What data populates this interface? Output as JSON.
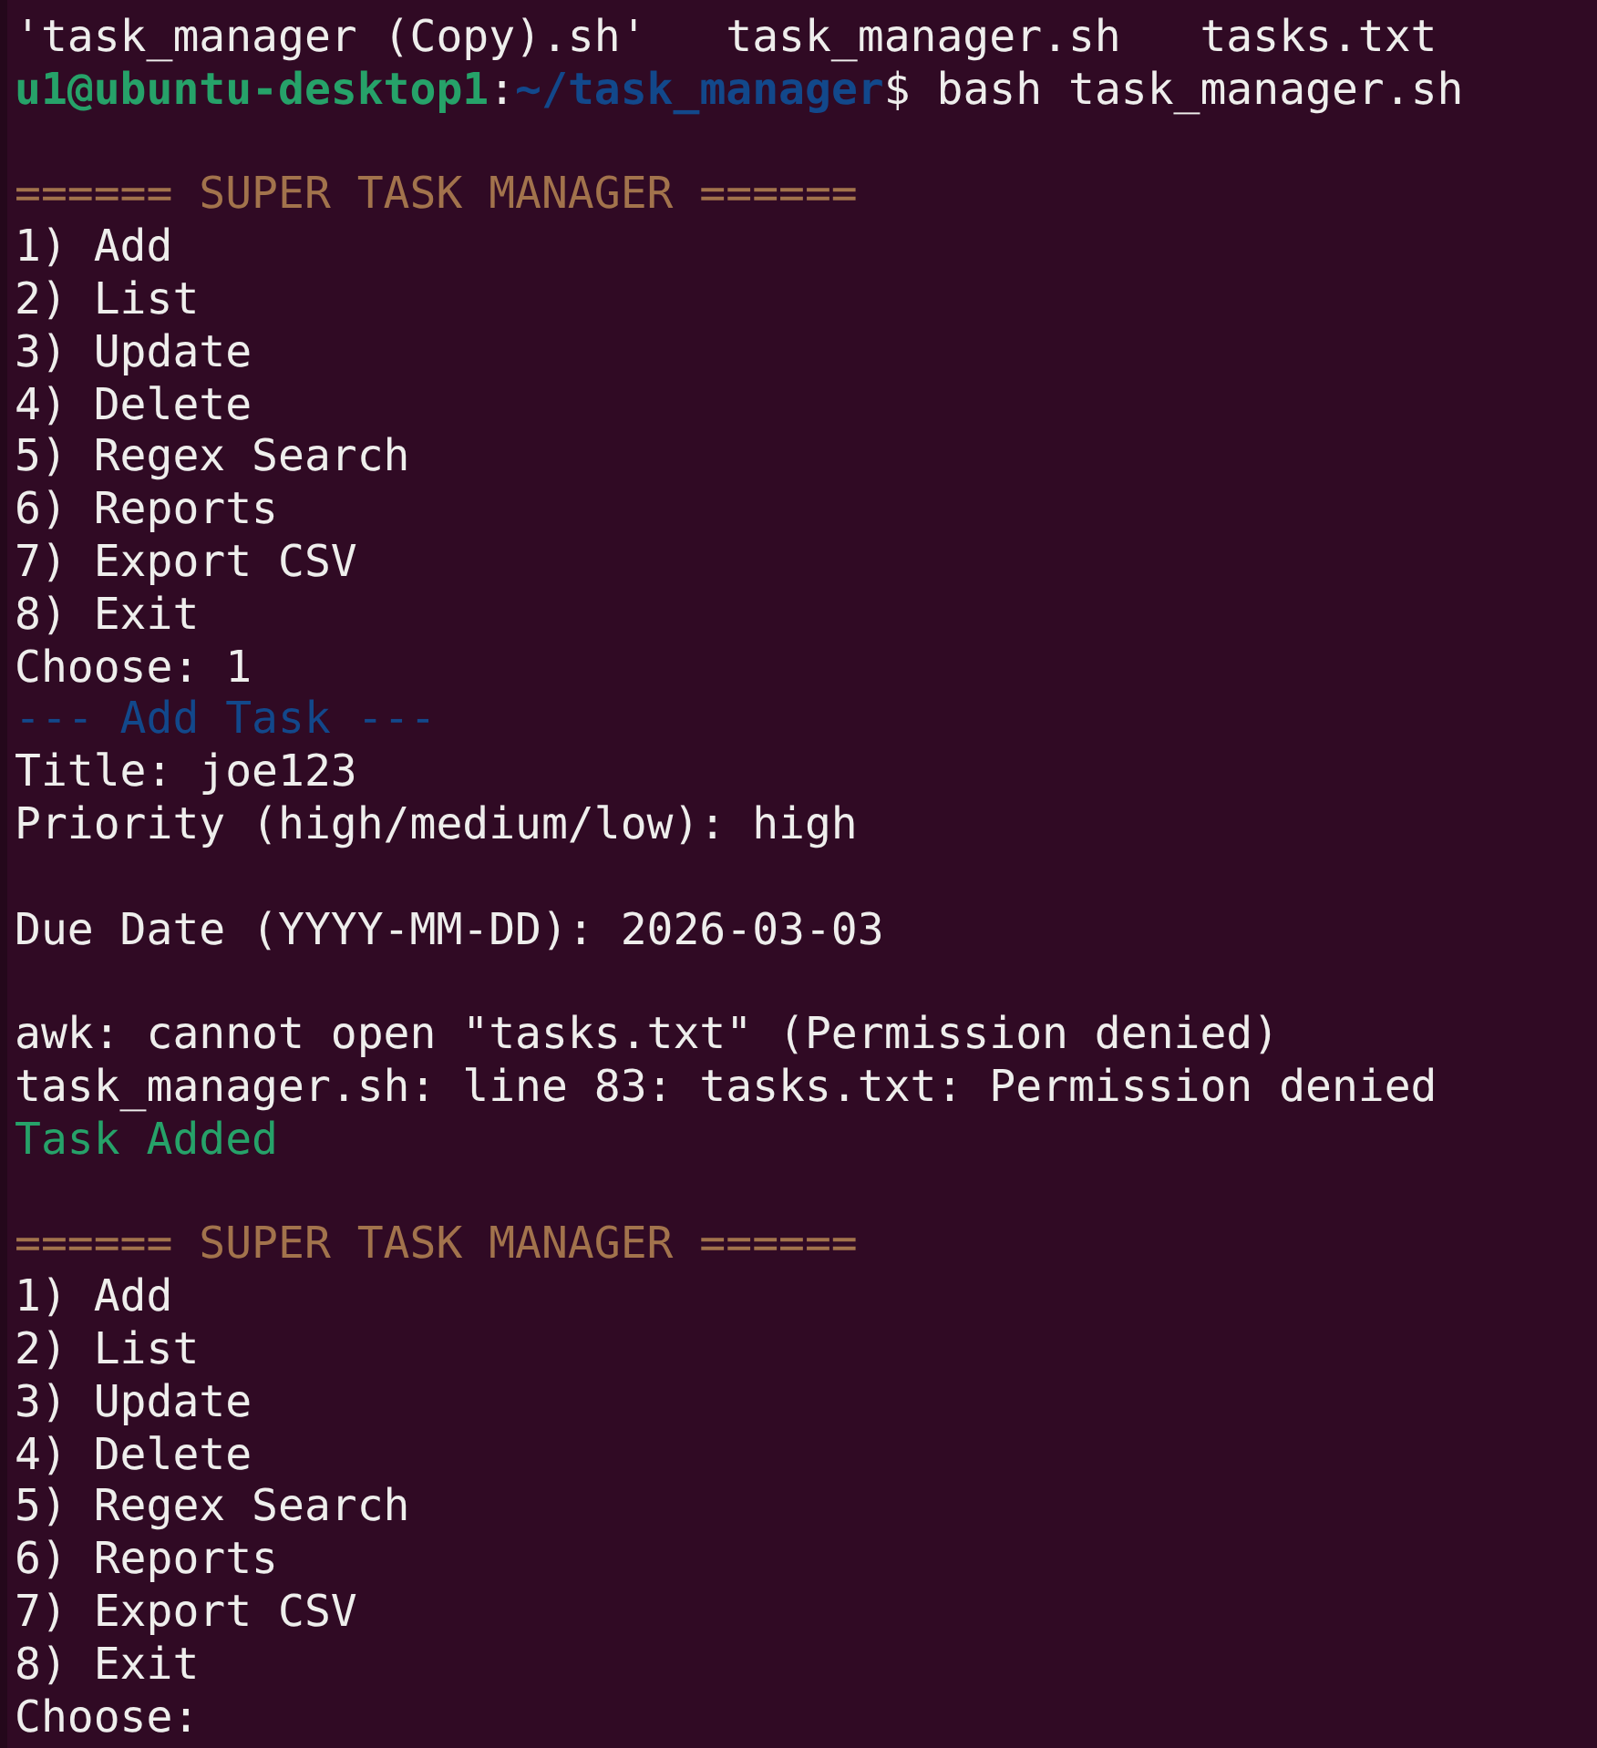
{
  "terminal": {
    "lines": [
      {
        "kind": "text",
        "segments": [
          {
            "kind": "plain",
            "text": "'task_manager (Copy).sh'   task_manager.sh   tasks.txt"
          }
        ]
      },
      {
        "kind": "text",
        "segments": [
          {
            "kind": "user",
            "text": "u1@ubuntu-desktop1"
          },
          {
            "kind": "plain",
            "text": ":"
          },
          {
            "kind": "path",
            "text": "~/task_manager"
          },
          {
            "kind": "plain",
            "text": "$ bash task_manager.sh"
          }
        ]
      },
      {
        "kind": "blank"
      },
      {
        "kind": "text",
        "segments": [
          {
            "kind": "header",
            "text": "====== SUPER TASK MANAGER ======"
          }
        ]
      },
      {
        "kind": "text",
        "segments": [
          {
            "kind": "plain",
            "text": "1) Add"
          }
        ]
      },
      {
        "kind": "text",
        "segments": [
          {
            "kind": "plain",
            "text": "2) List"
          }
        ]
      },
      {
        "kind": "text",
        "segments": [
          {
            "kind": "plain",
            "text": "3) Update"
          }
        ]
      },
      {
        "kind": "text",
        "segments": [
          {
            "kind": "plain",
            "text": "4) Delete"
          }
        ]
      },
      {
        "kind": "text",
        "segments": [
          {
            "kind": "plain",
            "text": "5) Regex Search"
          }
        ]
      },
      {
        "kind": "text",
        "segments": [
          {
            "kind": "plain",
            "text": "6) Reports"
          }
        ]
      },
      {
        "kind": "text",
        "segments": [
          {
            "kind": "plain",
            "text": "7) Export CSV"
          }
        ]
      },
      {
        "kind": "text",
        "segments": [
          {
            "kind": "plain",
            "text": "8) Exit"
          }
        ]
      },
      {
        "kind": "text",
        "segments": [
          {
            "kind": "plain",
            "text": "Choose: 1"
          }
        ]
      },
      {
        "kind": "text",
        "segments": [
          {
            "kind": "heading",
            "text": "--- Add Task ---"
          }
        ]
      },
      {
        "kind": "text",
        "segments": [
          {
            "kind": "plain",
            "text": "Title: joe123"
          }
        ]
      },
      {
        "kind": "text",
        "segments": [
          {
            "kind": "plain",
            "text": "Priority (high/medium/low): high"
          }
        ]
      },
      {
        "kind": "blank"
      },
      {
        "kind": "text",
        "segments": [
          {
            "kind": "plain",
            "text": "Due Date (YYYY-MM-DD): 2026-03-03"
          }
        ]
      },
      {
        "kind": "blank"
      },
      {
        "kind": "text",
        "segments": [
          {
            "kind": "plain",
            "text": "awk: cannot open \"tasks.txt\" (Permission denied)"
          }
        ]
      },
      {
        "kind": "text",
        "segments": [
          {
            "kind": "plain",
            "text": "task_manager.sh: line 83: tasks.txt: Permission denied"
          }
        ]
      },
      {
        "kind": "text",
        "segments": [
          {
            "kind": "success",
            "text": "Task Added"
          }
        ]
      },
      {
        "kind": "blank"
      },
      {
        "kind": "text",
        "segments": [
          {
            "kind": "header",
            "text": "====== SUPER TASK MANAGER ======"
          }
        ]
      },
      {
        "kind": "text",
        "segments": [
          {
            "kind": "plain",
            "text": "1) Add"
          }
        ]
      },
      {
        "kind": "text",
        "segments": [
          {
            "kind": "plain",
            "text": "2) List"
          }
        ]
      },
      {
        "kind": "text",
        "segments": [
          {
            "kind": "plain",
            "text": "3) Update"
          }
        ]
      },
      {
        "kind": "text",
        "segments": [
          {
            "kind": "plain",
            "text": "4) Delete"
          }
        ]
      },
      {
        "kind": "text",
        "segments": [
          {
            "kind": "plain",
            "text": "5) Regex Search"
          }
        ]
      },
      {
        "kind": "text",
        "segments": [
          {
            "kind": "plain",
            "text": "6) Reports"
          }
        ]
      },
      {
        "kind": "text",
        "segments": [
          {
            "kind": "plain",
            "text": "7) Export CSV"
          }
        ]
      },
      {
        "kind": "text",
        "segments": [
          {
            "kind": "plain",
            "text": "8) Exit"
          }
        ]
      },
      {
        "kind": "text",
        "segments": [
          {
            "kind": "plain",
            "text": "Choose:"
          }
        ]
      }
    ]
  }
}
